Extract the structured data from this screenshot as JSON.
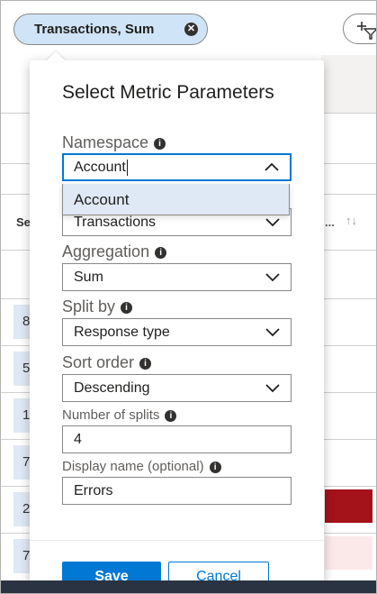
{
  "chip": {
    "label": "Transactions, Sum",
    "close_glyph": "✕",
    "icon": "close-circle-icon"
  },
  "add_filter": {
    "icon": "add-filter-icon"
  },
  "table_bg": {
    "left_header": "Se",
    "right_header": "...",
    "sort_glyph": "↑↓",
    "rows": [
      "8",
      "5",
      "1",
      "7",
      "2",
      "7"
    ]
  },
  "popup": {
    "title": "Select Metric Parameters",
    "namespace": {
      "label": "Namespace",
      "value": "Account",
      "option": "Account"
    },
    "metric": {
      "value": "Transactions"
    },
    "aggregation": {
      "label": "Aggregation",
      "value": "Sum"
    },
    "split_by": {
      "label": "Split by",
      "value": "Response type"
    },
    "sort_order": {
      "label": "Sort order",
      "value": "Descending"
    },
    "number_of_splits": {
      "label": "Number of splits",
      "value": "4"
    },
    "display_name": {
      "label": "Display name (optional)",
      "value": "Errors"
    },
    "save_label": "Save",
    "cancel_label": "Cancel"
  },
  "colors": {
    "accent": "#0078d4",
    "chip_bg": "#cfe4f6",
    "bar_strong": "#a4121a",
    "bar_light": "#fbe9ea"
  }
}
